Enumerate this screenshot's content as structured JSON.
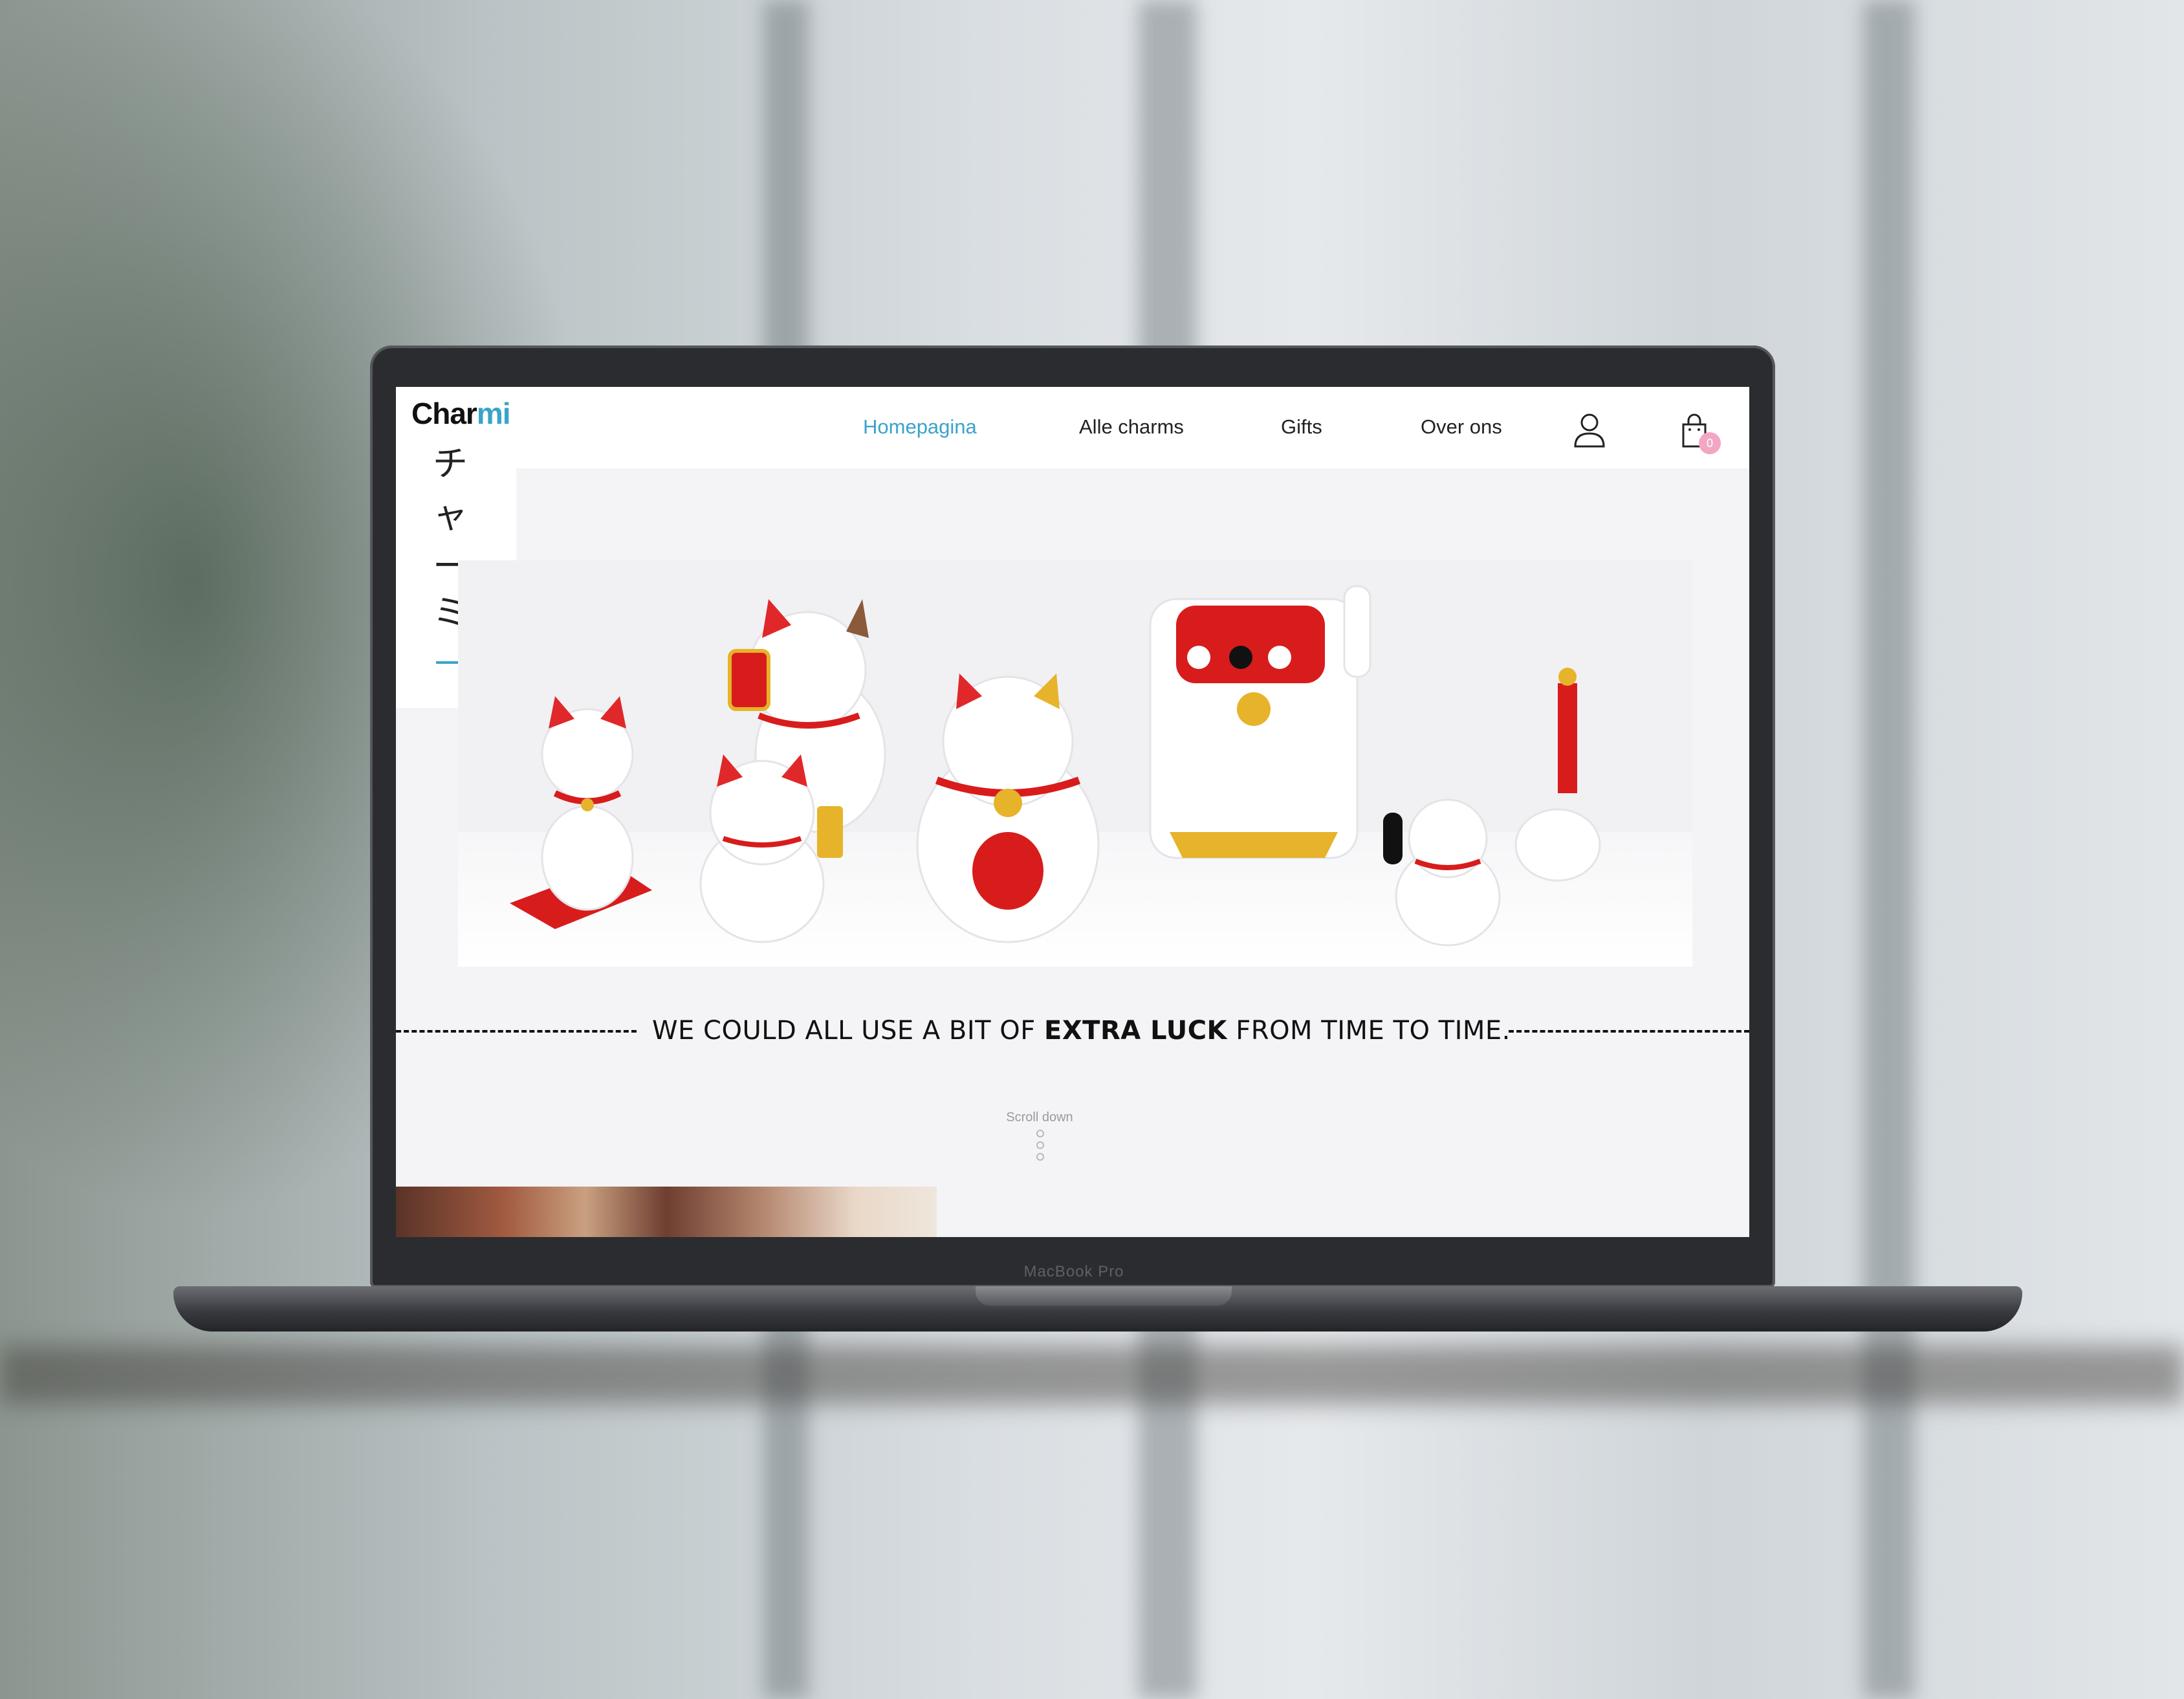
{
  "device": {
    "label": "MacBook Pro"
  },
  "site": {
    "logo": {
      "part1": "Char",
      "part2": "mi"
    },
    "katakana": [
      "チ",
      "ャ",
      "ー",
      "ミ"
    ],
    "accent_color": "#3aa3c8",
    "nav": {
      "items": [
        {
          "label": "Homepagina",
          "active": true
        },
        {
          "label": "Alle charms",
          "active": false
        },
        {
          "label": "Gifts",
          "active": false
        },
        {
          "label": "Over ons",
          "active": false
        }
      ],
      "user_icon": "user-icon",
      "cart_icon": "shopping-bag-icon",
      "cart_count": "0"
    },
    "hero": {
      "image": "maneki-neko-lucky-cat-figurines"
    },
    "tagline": {
      "before": "WE COULD ALL USE A BIT OF ",
      "bold": "EXTRA LUCK",
      "after": " FROM TIME TO TIME."
    },
    "scroll": {
      "label": "Scroll down"
    },
    "next_section": {
      "image": "charms-photo-preview"
    }
  }
}
